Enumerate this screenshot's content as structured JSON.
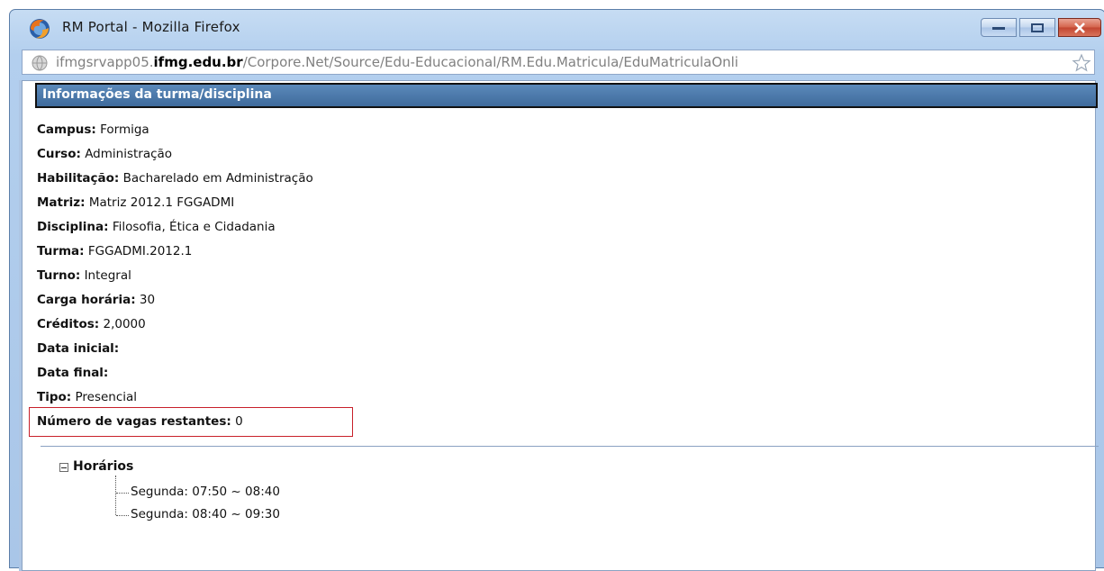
{
  "window": {
    "title": "RM Portal - Mozilla Firefox",
    "url_prefix": "ifmgsrvapp05.",
    "url_domain": "ifmg.edu.br",
    "url_path": "/Corpore.Net/Source/Edu-Educacional/RM.Edu.Matricula/EduMatriculaOnli"
  },
  "panel": {
    "title": "Informações da turma/disciplina"
  },
  "fields": [
    {
      "label": "Campus:",
      "value": "Formiga"
    },
    {
      "label": "Curso:",
      "value": "Administração"
    },
    {
      "label": "Habilitação:",
      "value": "Bacharelado em Administração"
    },
    {
      "label": "Matriz:",
      "value": "Matriz 2012.1 FGGADMI"
    },
    {
      "label": "Disciplina:",
      "value": "Filosofia, Ética e Cidadania"
    },
    {
      "label": "Turma:",
      "value": "FGGADMI.2012.1"
    },
    {
      "label": "Turno:",
      "value": "Integral"
    },
    {
      "label": "Carga horária:",
      "value": "30"
    },
    {
      "label": "Créditos:",
      "value": "2,0000"
    },
    {
      "label": "Data inicial:",
      "value": ""
    },
    {
      "label": "Data final:",
      "value": ""
    },
    {
      "label": "Tipo:",
      "value": "Presencial"
    },
    {
      "label": "Número de vagas restantes:",
      "value": "0"
    }
  ],
  "schedule": {
    "label": "Horários",
    "items": [
      "Segunda: 07:50 ~ 08:40",
      "Segunda: 08:40 ~ 09:30"
    ]
  },
  "colors": {
    "header_bg": "#4a78a9",
    "highlight_border": "#c8202a",
    "close_button": "#c9503a"
  }
}
